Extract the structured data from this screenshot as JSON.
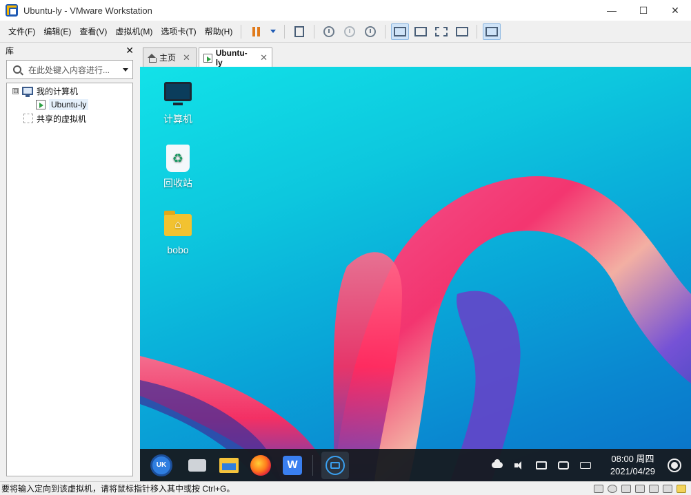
{
  "window": {
    "title": "Ubuntu-ly - VMware Workstation",
    "minimize": "—",
    "maximize": "☐",
    "close": "✕"
  },
  "menu": {
    "items": [
      "文件(F)",
      "编辑(E)",
      "查看(V)",
      "虚拟机(M)",
      "选项卡(T)",
      "帮助(H)"
    ]
  },
  "toolbar": {
    "icons": [
      "pause-icon",
      "dropdown-icon",
      "send-keys-icon",
      "snapshot-take-icon",
      "snapshot-revert-icon",
      "snapshot-manager-icon",
      "sidebar-view-icon",
      "thumbnail-bar-icon",
      "fullscreen-icon",
      "unity-icon",
      "console-view-icon"
    ]
  },
  "library": {
    "title": "库",
    "close": "✕",
    "search_placeholder": "在此处键入内容进行...",
    "tree": {
      "my_computer": "我的计算机",
      "toggle": "⊟",
      "vm": "Ubuntu-ly",
      "shared": "共享的虚拟机"
    }
  },
  "tabs": [
    {
      "label": "主页",
      "close": "✕"
    },
    {
      "label": "Ubuntu-ly",
      "close": "✕"
    }
  ],
  "desktop": {
    "icons": [
      {
        "label": "计算机"
      },
      {
        "label": "回收站",
        "glyph": "♻"
      },
      {
        "label": "bobo",
        "glyph": "⌂"
      }
    ],
    "taskbar": {
      "uk_text": "UK",
      "wps_text": "W",
      "time": "08:00 周四",
      "date": "2021/04/29"
    },
    "colors": {
      "wallpaper_top": "#12e2e8",
      "wallpaper_bottom": "#0a70c8",
      "ribbon": "#ff3a7a"
    }
  },
  "statusbar": {
    "text": "要将输入定向到该虚拟机，请将鼠标指针移入其中或按 Ctrl+G。"
  }
}
